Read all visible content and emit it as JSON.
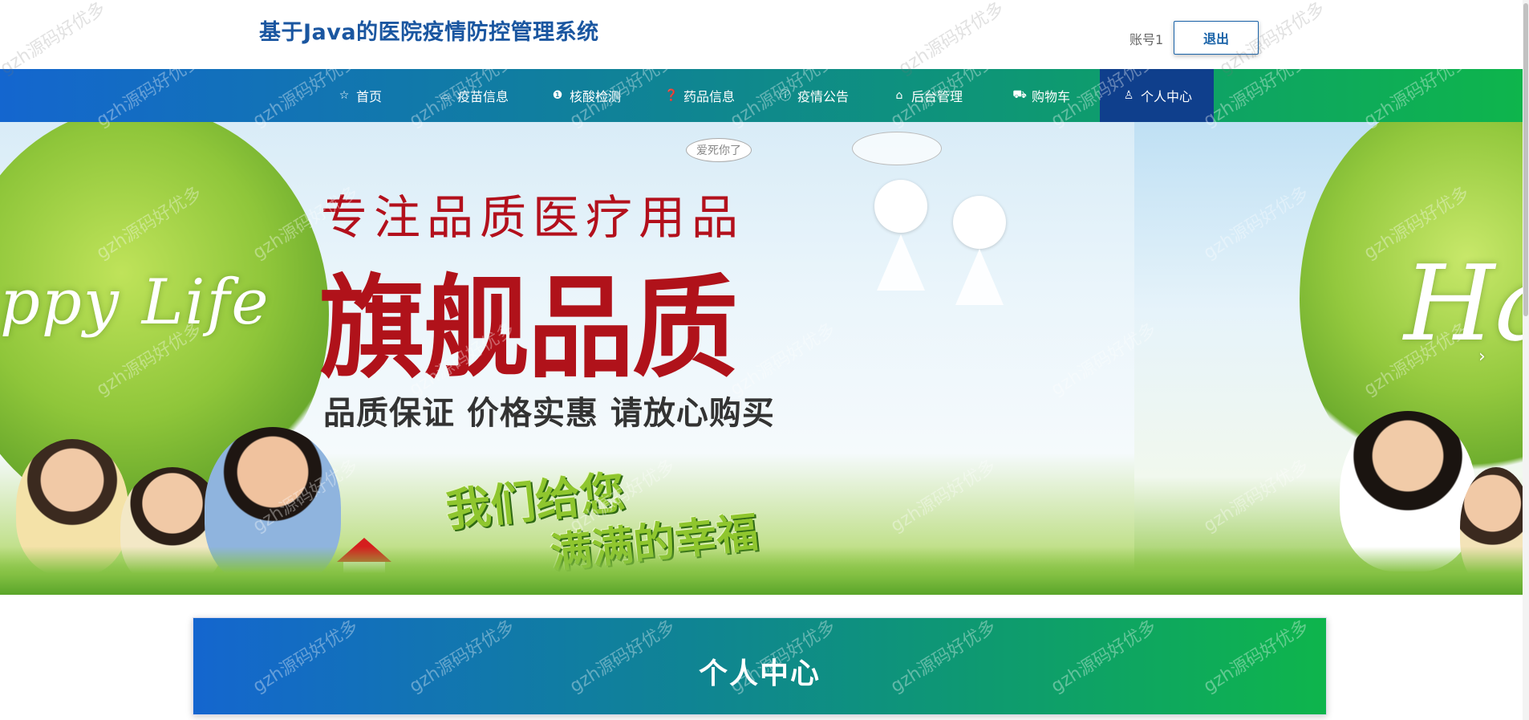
{
  "header": {
    "title": "基于Java的医院疫情防控管理系统",
    "account": "账号1",
    "logout_label": "退出"
  },
  "nav": {
    "items": [
      {
        "label": "首页",
        "icon": "star-icon",
        "glyph": "☆"
      },
      {
        "label": "疫苗信息",
        "icon": "bag-icon",
        "glyph": "🛍"
      },
      {
        "label": "核酸检测",
        "icon": "info-icon",
        "glyph": "❶"
      },
      {
        "label": "药品信息",
        "icon": "question-icon",
        "glyph": "❓"
      },
      {
        "label": "疫情公告",
        "icon": "info-icon",
        "glyph": "ⓘ"
      },
      {
        "label": "后台管理",
        "icon": "gift-icon",
        "glyph": "⌂"
      },
      {
        "label": "购物车",
        "icon": "cart-icon",
        "glyph": "🛒"
      },
      {
        "label": "个人中心",
        "icon": "user-icon",
        "glyph": "♙"
      }
    ],
    "active": "个人中心"
  },
  "banner": {
    "happy_left": "ppy Life",
    "happy_right": "Ha",
    "bubble": "爱死你了",
    "slogan_line1": "专注品质医疗用品",
    "slogan_line2": "旗舰品质",
    "slogan_line3": "品质保证  价格实惠  请放心购买",
    "slogan_line4": "我们给您",
    "slogan_line5": "满满的幸福",
    "next_arrow": "›"
  },
  "section": {
    "title": "个人中心"
  },
  "watermark": "gzh源码好优多",
  "colors": {
    "nav_start": "#1466cf",
    "nav_end": "#0eb54c",
    "nav_active": "#0f3f8c",
    "title": "#1a56a0"
  }
}
